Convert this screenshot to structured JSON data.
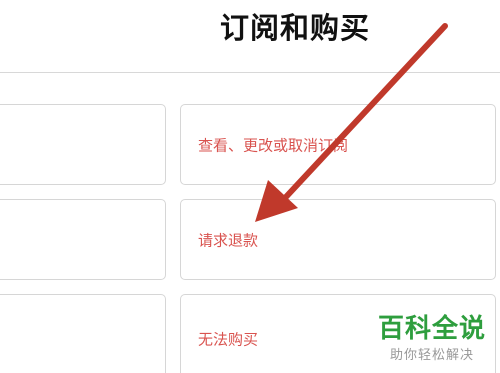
{
  "header": {
    "title": "订阅和购买"
  },
  "options": [
    {
      "label": "查看、更改或取消订阅"
    },
    {
      "label": "请求退款"
    },
    {
      "label": "无法购买"
    }
  ],
  "annotation": {
    "arrow_color": "#c0392b"
  },
  "watermark": {
    "brand": "百科全说",
    "slogan": "助你轻松解决",
    "brand_color": "#2e9e3e"
  },
  "colors": {
    "link_text": "#d9534f",
    "card_border": "#d6d6d6"
  }
}
